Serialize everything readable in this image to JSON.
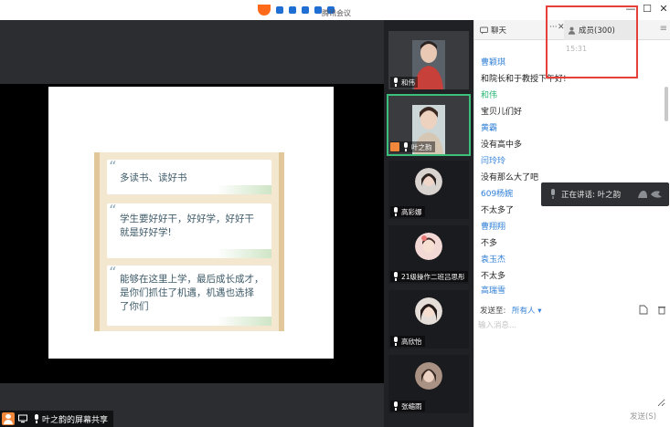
{
  "app": {
    "brand_name": "腾讯会议"
  },
  "window": {
    "minimize": "—",
    "maximize": "☐",
    "close": "✕"
  },
  "slide": {
    "quotes": [
      {
        "line1": "多读书、读好书",
        "line2": ""
      },
      {
        "line1": "学生要好好干，好好学，好好干",
        "line2": "就是好好学!"
      },
      {
        "line1": "能够在这里上学，最后成长成才，",
        "line2": "是你们抓住了机遇，机遇也选择",
        "line3": "了你们"
      }
    ]
  },
  "stage": {
    "status_text": "叶之韵的屏幕共享"
  },
  "thumbnails": [
    {
      "name": "和伟",
      "active": false
    },
    {
      "name": "叶之韵",
      "active": true
    },
    {
      "name": "高彩娜",
      "active": false
    },
    {
      "name": "21级操作二班吕思彤",
      "active": false
    },
    {
      "name": "高欣怡",
      "active": false
    },
    {
      "name": "张缩雨",
      "active": false
    }
  ],
  "panel": {
    "tab_chat": "聊天",
    "tab_members": "成员(300)",
    "more": "···",
    "close": "✕",
    "menu": "≡",
    "time": "15:31",
    "messages": [
      {
        "name": "曹颖琪",
        "text": "和院长和于教授下午好!"
      },
      {
        "name": "和伟",
        "text": "宝贝儿们好",
        "green": true
      },
      {
        "name": "黄霸",
        "text": "没有高中多"
      },
      {
        "name": "闫玲玲",
        "text": "没有那么大了吧"
      },
      {
        "name": "609杨婉",
        "text": "不太多了"
      },
      {
        "name": "曹翔翔",
        "text": "不多"
      },
      {
        "name": "袁玉杰",
        "text": "不太多"
      },
      {
        "name": "高瑞雪",
        "text": ""
      }
    ],
    "send_label": "发送至:",
    "send_target": "所有人 ▾",
    "input_placeholder": "输入消息...",
    "send_button": "发送(S)",
    "speaking": "正在讲话: 叶之韵"
  },
  "colors": {
    "accent_blue": "#2f7fd6",
    "accent_green": "#2ab673",
    "highlight_red": "#e5403a",
    "badge_orange": "#f0873a"
  }
}
